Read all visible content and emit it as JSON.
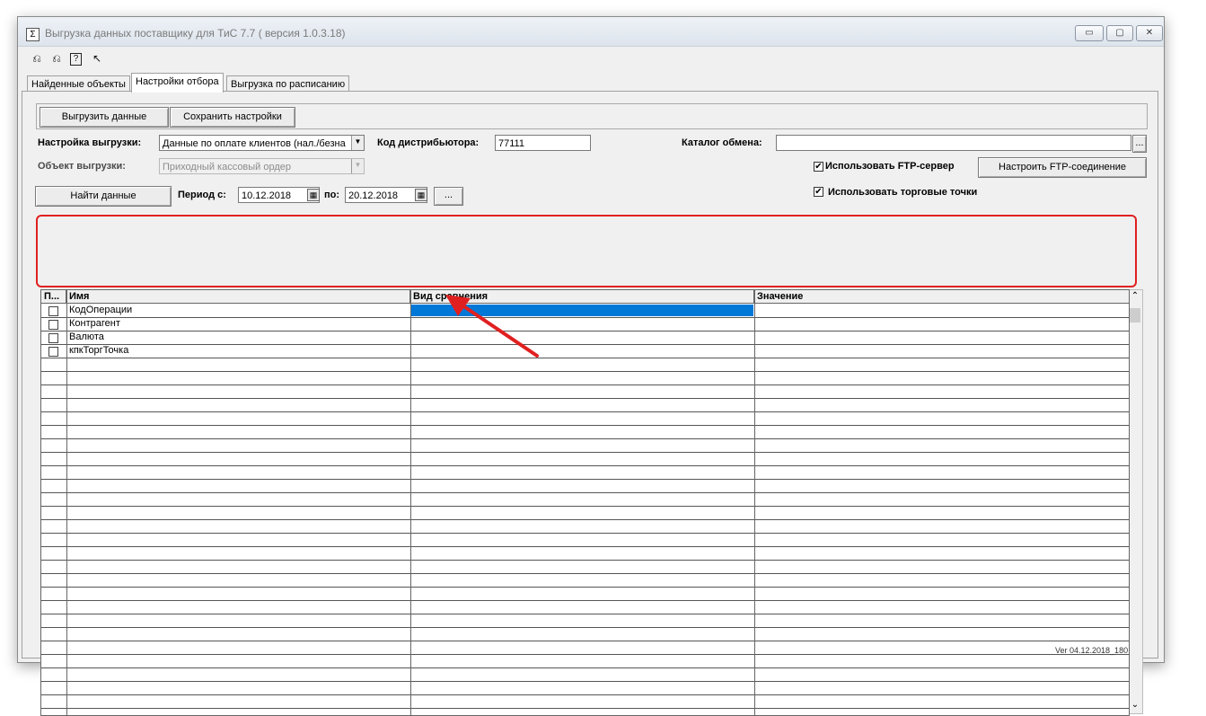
{
  "window": {
    "title": "Выгрузка данных поставщику для ТиС 7.7 ( версия 1.0.3.18)",
    "app_icon": "Σ",
    "controls": {
      "minimize": "▭",
      "maximize": "▢",
      "close": "✕"
    }
  },
  "toolbar": {
    "icons": [
      {
        "name": "unload-icon",
        "glyph": "⎌"
      },
      {
        "name": "load-icon",
        "glyph": "⎌"
      },
      {
        "name": "help-icon",
        "glyph": "?"
      },
      {
        "name": "pointer-help-icon",
        "glyph": "↖"
      }
    ]
  },
  "tabs": [
    {
      "label": "Найденные объекты",
      "active": false
    },
    {
      "label": "Настройки отбора",
      "active": true
    },
    {
      "label": "Выгрузка по расписанию",
      "active": false
    }
  ],
  "buttons": {
    "export": "Выгрузить данные",
    "save_settings": "Сохранить настройки",
    "find": "Найти данные",
    "ellipsis": "...",
    "catalog_browse": "...",
    "ftp_setup": "Настроить FTP-соединение"
  },
  "form": {
    "export_setting_label": "Настройка выгрузки:",
    "export_setting_value": "Данные по оплате клиентов (нал./безна",
    "export_object_label": "Объект выгрузки:",
    "export_object_value": "Приходный кассовый ордер",
    "distributor_code_label": "Код дистрибьютора:",
    "distributor_code_value": "77111",
    "catalog_label": "Каталог обмена:",
    "catalog_value": "",
    "period_from_label": "Период с:",
    "period_from_value": "10.12.2018",
    "period_to_label": "по:",
    "period_to_value": "20.12.2018",
    "use_ftp_label": "Использовать FTP-сервер",
    "use_ftp_checked": true,
    "use_outlets_label": "Использовать торговые точки",
    "use_outlets_checked": true,
    "dropdown_glyph": "▼",
    "calendar_glyph": "▦",
    "check_glyph": "✔"
  },
  "grid": {
    "columns": [
      "П...",
      "Имя",
      "Вид сравнения",
      "Значение"
    ],
    "rows": [
      {
        "checked": false,
        "name": "КодОперации",
        "comparison": "",
        "value": ""
      },
      {
        "checked": false,
        "name": "Контрагент",
        "comparison": "",
        "value": ""
      },
      {
        "checked": false,
        "name": "Валюта",
        "comparison": "",
        "value": ""
      },
      {
        "checked": false,
        "name": "кпкТоргТочка",
        "comparison": "",
        "value": ""
      }
    ],
    "selection_color": "#0078d7",
    "scroll_up": "⌃",
    "scroll_down": "⌄"
  },
  "annotation": {
    "color": "#e02020"
  },
  "version_text": "Ver 04.12.2018_180"
}
